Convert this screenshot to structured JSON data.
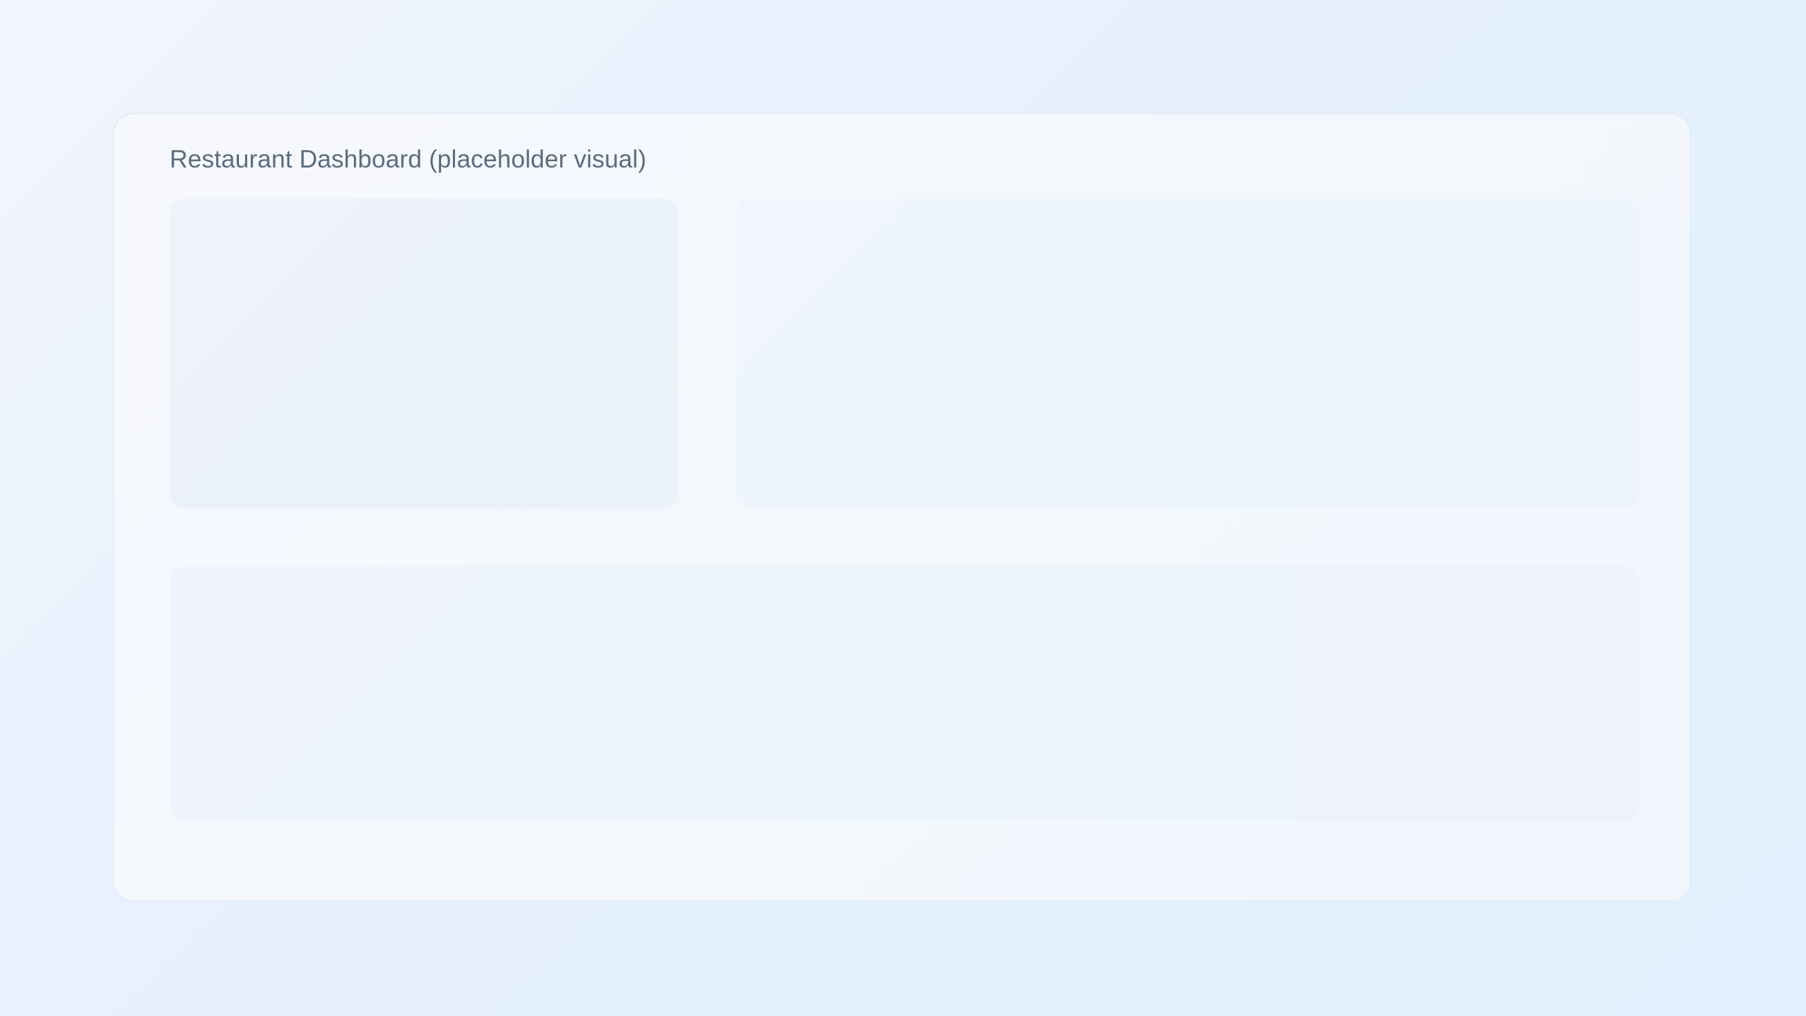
{
  "dashboard": {
    "title": "Restaurant Dashboard (placeholder visual)"
  },
  "colors": {
    "page_background": "#e8f1fd",
    "card_background": "#f4f8fd",
    "title_text": "#5c6d80",
    "panel_left": "#edf2fa",
    "panel_right": "#eef5fe",
    "panel_bottom": "#eef4fd",
    "panel_bottom_side": "#edf2fb"
  }
}
